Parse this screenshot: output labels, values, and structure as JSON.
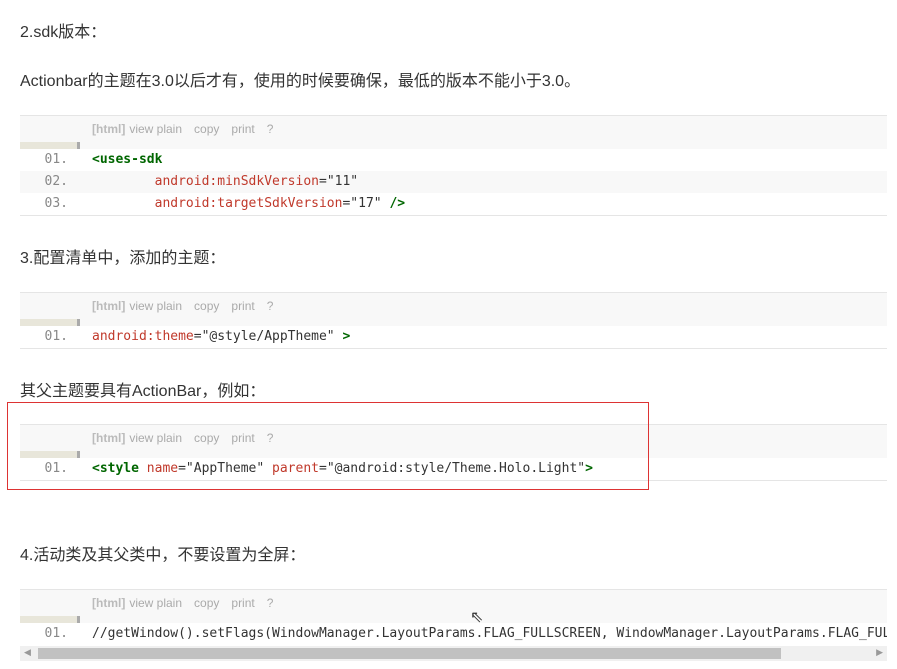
{
  "sections": {
    "h2": "2.sdk版本：",
    "p2": "Actionbar的主题在3.0以后才有，使用的时候要确保，最低的版本不能小于3.0。",
    "h3": "3.配置清单中，添加的主题：",
    "p3": "其父主题要具有ActionBar，例如：",
    "h4": "4.活动类及其父类中，不要设置为全屏："
  },
  "toolbar": {
    "lang": "[html]",
    "view_plain": "view plain",
    "copy": "copy",
    "print": "print",
    "help": "?"
  },
  "blocks": [
    {
      "lines": [
        {
          "num": "01.",
          "parts": [
            {
              "t": "tag",
              "v": "<uses-sdk"
            }
          ]
        },
        {
          "num": "02.",
          "parts": [
            {
              "t": "plain",
              "v": "        "
            },
            {
              "t": "attr",
              "v": "android:minSdkVersion"
            },
            {
              "t": "str",
              "v": "=\"11\""
            }
          ]
        },
        {
          "num": "03.",
          "parts": [
            {
              "t": "plain",
              "v": "        "
            },
            {
              "t": "attr",
              "v": "android:targetSdkVersion"
            },
            {
              "t": "str",
              "v": "=\"17\" "
            },
            {
              "t": "tag",
              "v": "/>"
            }
          ]
        }
      ]
    },
    {
      "lines": [
        {
          "num": "01.",
          "parts": [
            {
              "t": "attr",
              "v": "android:theme"
            },
            {
              "t": "str",
              "v": "=\"@style/AppTheme\" "
            },
            {
              "t": "tag",
              "v": ">"
            }
          ]
        }
      ]
    },
    {
      "lines": [
        {
          "num": "01.",
          "parts": [
            {
              "t": "tag",
              "v": "<style "
            },
            {
              "t": "attr",
              "v": "name"
            },
            {
              "t": "str",
              "v": "=\"AppTheme\" "
            },
            {
              "t": "attr",
              "v": "parent"
            },
            {
              "t": "str",
              "v": "=\"@android:style/Theme.Holo.Light\""
            },
            {
              "t": "tag",
              "v": ">"
            }
          ]
        }
      ]
    },
    {
      "lines": [
        {
          "num": "01.",
          "parts": [
            {
              "t": "plain",
              "v": "//getWindow().setFlags(WindowManager.LayoutParams.FLAG_FULLSCREEN, WindowManager.LayoutParams.FLAG_FULLSCREEN);"
            }
          ]
        }
      ]
    }
  ],
  "colors": {
    "tag": "#006600",
    "attr": "#c0392b",
    "highlight_box": "#dd3333"
  }
}
